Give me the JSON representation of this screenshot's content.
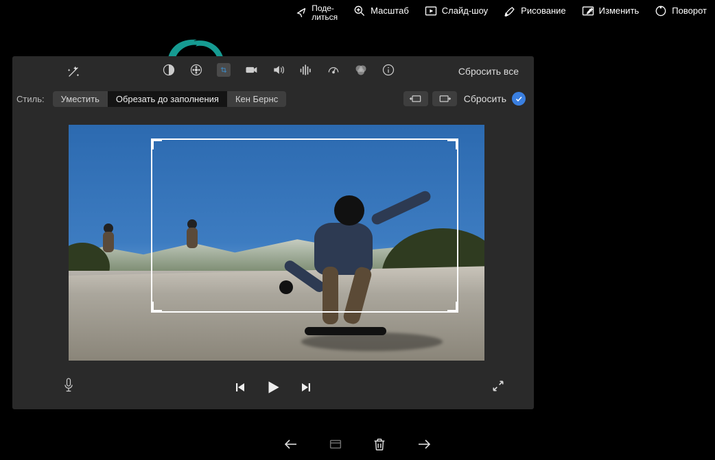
{
  "top_menu": {
    "share": "Поде-\nлиться",
    "zoom": "Масштаб",
    "slideshow": "Слайд-шоу",
    "draw": "Рисование",
    "edit": "Изменить",
    "rotate": "Поворот"
  },
  "toolbar": {
    "reset_all": "Сбросить все"
  },
  "style_row": {
    "label": "Стиль:",
    "fit": "Уместить",
    "crop_fill": "Обрезать до заполнения",
    "ken_burns": "Кен Бернс",
    "reset": "Сбросить"
  },
  "annotation": {
    "color": "#17a39a"
  }
}
